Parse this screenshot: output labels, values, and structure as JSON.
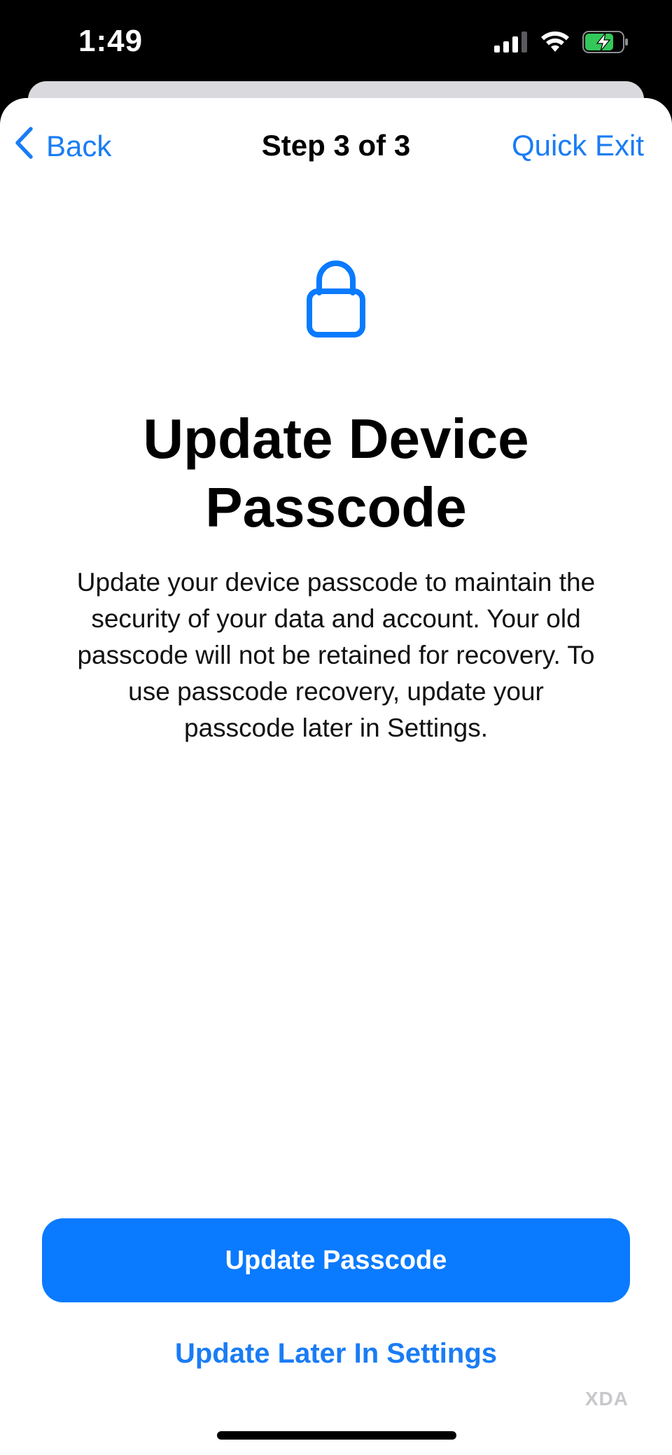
{
  "status_bar": {
    "time": "1:49",
    "icons": [
      "signal-icon",
      "wifi-icon",
      "battery-charging-icon"
    ]
  },
  "nav": {
    "back_label": "Back",
    "title": "Step 3 of 3",
    "exit_label": "Quick Exit"
  },
  "content": {
    "icon": "lock-icon",
    "heading": "Update Device Passcode",
    "description": "Update your device passcode to maintain the security of your data and account. Your old passcode will not be retained for recovery. To use passcode recovery, update your passcode later in Settings."
  },
  "actions": {
    "primary_label": "Update Passcode",
    "secondary_label": "Update Later In Settings"
  },
  "watermark": {
    "text": "XDA"
  },
  "colors": {
    "accent": "#1a7cf5",
    "primary_button": "#0a7aff",
    "battery": "#34c759"
  }
}
